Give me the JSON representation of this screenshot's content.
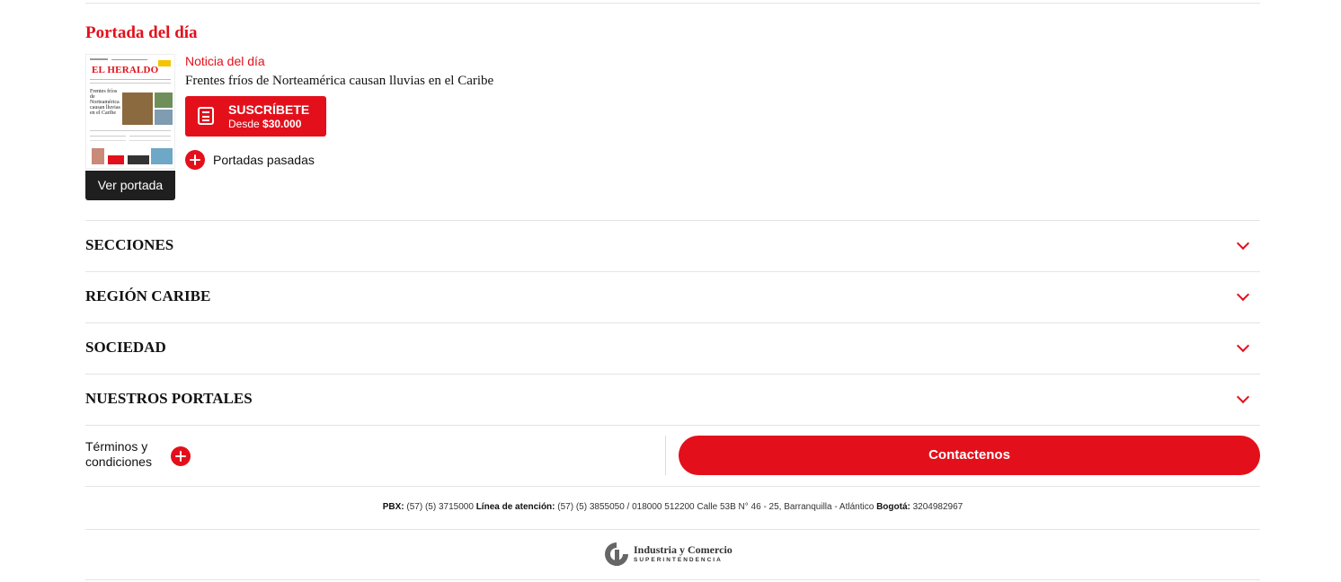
{
  "portada": {
    "title": "Portada del día",
    "cover_masthead": "EL HERALDO",
    "cover_headline": "Frentes fríos de Norteamérica causan lluvias en el Caribe",
    "view_label": "Ver portada",
    "noticia_label": "Noticia del día",
    "noticia_title": "Frentes fríos de Norteamérica causan lluvias en el Caribe",
    "subscribe_title": "SUSCRÍBETE",
    "subscribe_prefix": "Desde",
    "subscribe_price": "$30.000",
    "past_covers_label": "Portadas pasadas"
  },
  "accordion": [
    {
      "label": "SECCIONES"
    },
    {
      "label": "REGIÓN CARIBE"
    },
    {
      "label": "SOCIEDAD"
    },
    {
      "label": "NUESTROS PORTALES"
    }
  ],
  "footer": {
    "terms_line1": "Términos y",
    "terms_line2": "condiciones",
    "contact_label": "Contactenos",
    "pbx_label": "PBX:",
    "pbx_value": " (57) (5) 3715000 ",
    "linea_label": "Línea de atención:",
    "linea_value": " (57) (5) 3855050 / 018000 512200 Calle 53B N° 46 - 25, Barranquilla - Atlántico ",
    "bogota_label": "Bogotá:",
    "bogota_value": " 3204982967",
    "sic_title": "Industria y Comercio",
    "sic_subtitle": "SUPERINTENDENCIA"
  },
  "colors": {
    "accent": "#e3101b",
    "dark_button": "#1f1f1f",
    "divider": "#e4e4e4"
  },
  "icons": {
    "accordion_toggle": "chevron-down-icon",
    "add": "plus-circle-icon",
    "subscribe": "newspaper-icon"
  }
}
